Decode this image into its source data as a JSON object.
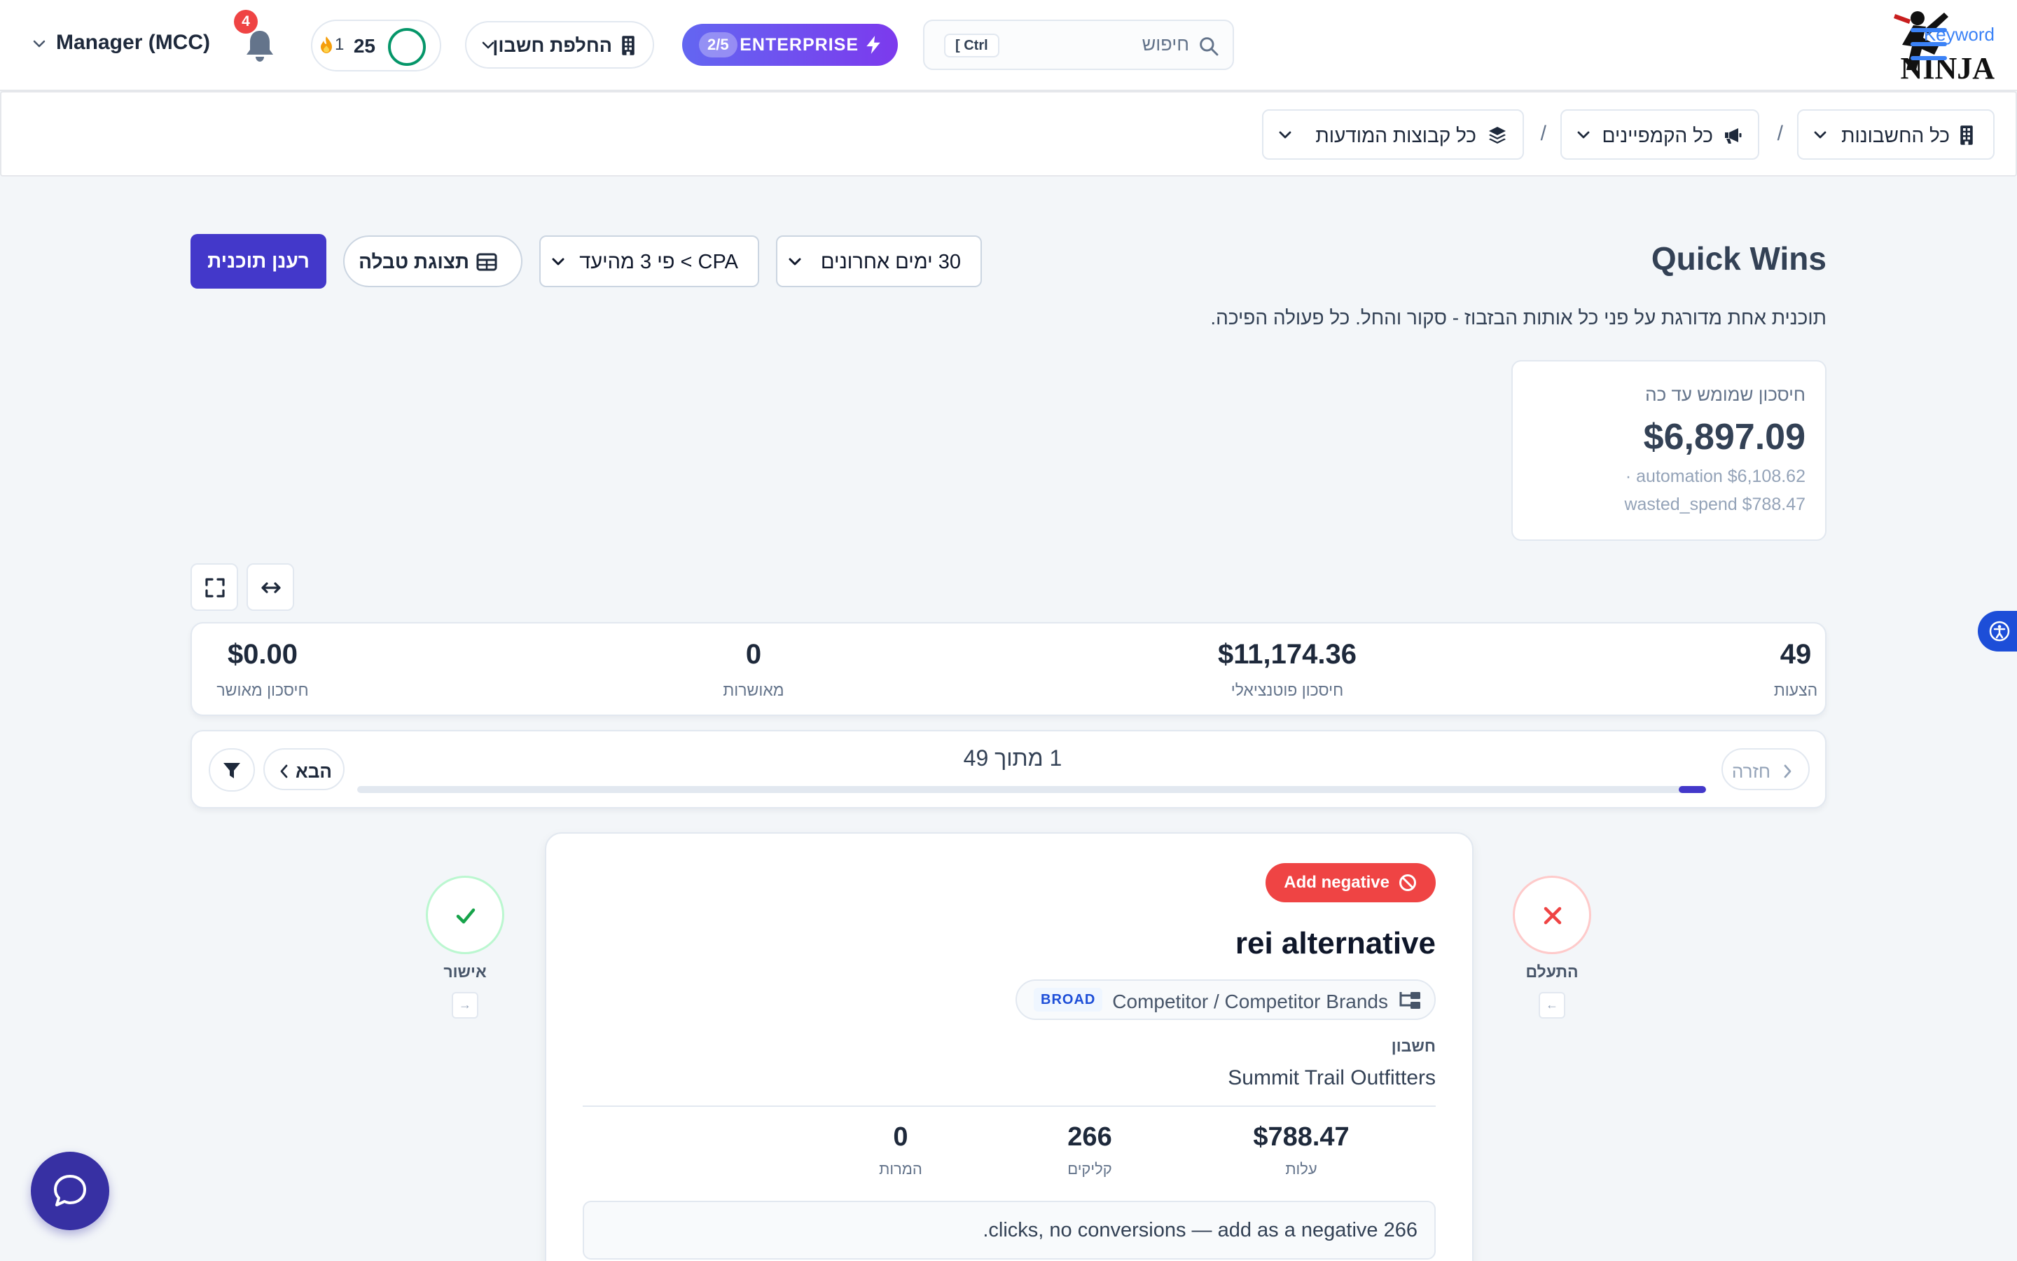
{
  "topbar": {
    "logo_text_top": "Keyword",
    "logo_text_bottom": "NINJA",
    "search": {
      "placeholder": "חיפוש",
      "shortcut": "[ Ctrl"
    },
    "plan": {
      "label": "ENTERPRISE",
      "step": "2/5"
    },
    "account_switcher": "החלפת חשבון",
    "streak": {
      "score": "25",
      "fire_count": "1"
    },
    "notifications_count": "4",
    "account_mode": "Manager (MCC)"
  },
  "breadcrumb": {
    "accounts": "כל החשבונות",
    "campaigns": "כל הקמפיינים",
    "ad_groups": "כל קבוצות המודעות",
    "separator": "/"
  },
  "header": {
    "title": "Quick Wins",
    "subtitle": "תוכנית אחת מדורגת על פני כל אותות הבזבוז - סקור והחל. כל פעולה הפיכה.",
    "refresh_button": "רענן תוכנית",
    "table_view_button": "תצוגת טבלה",
    "cpa_filter": "CPA > פי 3 מהיעד",
    "date_range": "30 ימים אחרונים"
  },
  "savings": {
    "label": "חיסכון שמומש עד כה",
    "value": "$6,897.09",
    "line1": "· automation $6,108.62",
    "line2": "wasted_spend $788.47"
  },
  "stats": [
    {
      "value": "49",
      "label": "הצעות"
    },
    {
      "value": "$11,174.36",
      "label": "חיסכון פוטנציאלי"
    },
    {
      "value": "0",
      "label": "מאושרות"
    },
    {
      "value": "$0.00",
      "label": "חיסכון מאושר"
    }
  ],
  "pager": {
    "back": "חזרה",
    "count": "1 מתוך 49",
    "next": "הבא",
    "progress": 1,
    "total": 49
  },
  "actions": {
    "ignore_label": "התעלם",
    "ignore_key": "←",
    "approve_label": "אישור",
    "approve_key": "→"
  },
  "card": {
    "badge": "Add negative",
    "keyword": "rei alternative",
    "path": "Competitor / Competitor Brands",
    "match_type": "BROAD",
    "account_label": "חשבון",
    "account_name": "Summit Trail Outfitters",
    "metrics": [
      {
        "value": "$788.47",
        "label": "עלות"
      },
      {
        "value": "266",
        "label": "קליקים"
      },
      {
        "value": "0",
        "label": "המרות"
      }
    ],
    "reason": ".clicks, no conversions — add as a negative 266"
  },
  "colors": {
    "primary": "#4338ca",
    "accent_blue": "#3b82f6",
    "danger": "#ef4444",
    "success": "#16a34a",
    "streak_ring": "#059669"
  },
  "icons": [
    "search-icon",
    "bolt-icon",
    "building-icon",
    "fire-icon",
    "bell-icon",
    "megaphone-icon",
    "layers-icon",
    "table-icon",
    "expand-icon",
    "arrows-horizontal-icon",
    "filter-icon",
    "close-icon",
    "check-icon",
    "ban-icon",
    "folder-tree-icon",
    "accessibility-icon",
    "chat-icon"
  ]
}
